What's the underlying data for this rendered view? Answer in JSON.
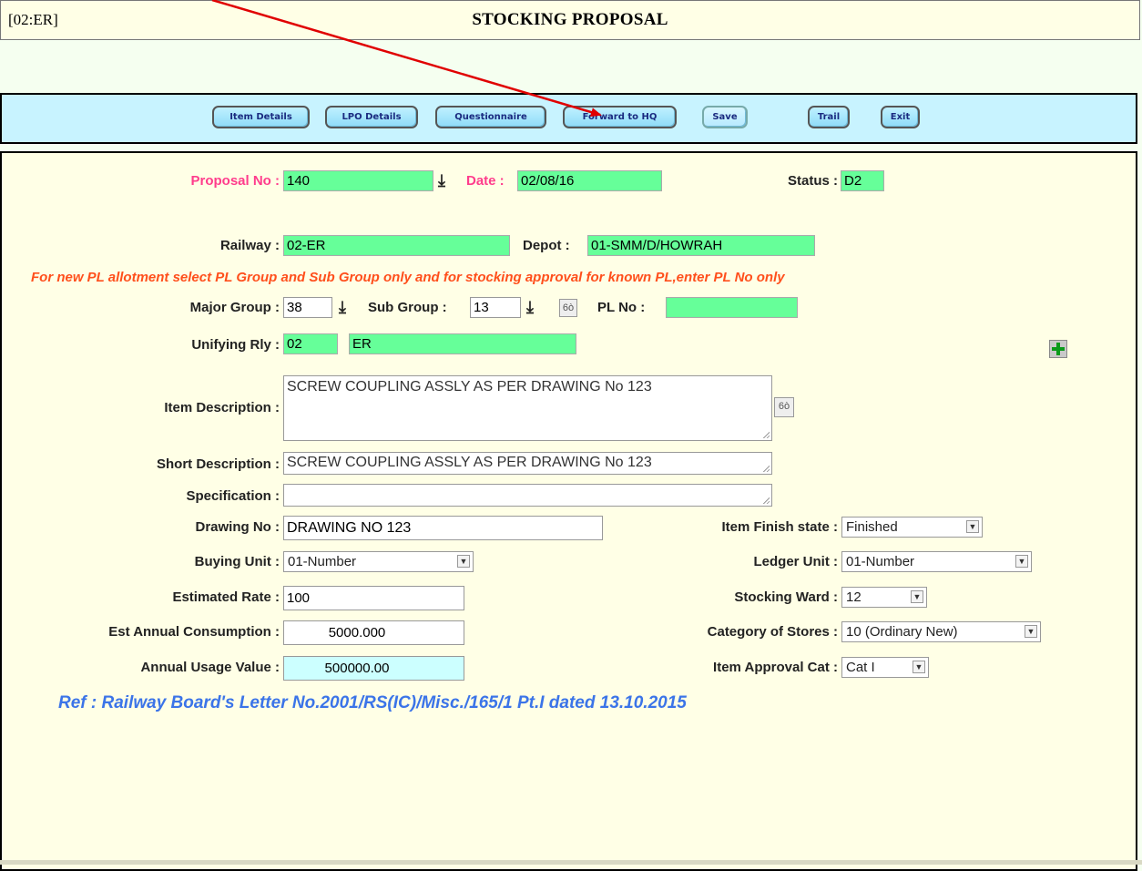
{
  "window": {
    "screen_code": "[02:ER]",
    "title": "STOCKING PROPOSAL"
  },
  "toolbar": {
    "item_details": "Item Details",
    "lpo_details": "LPO Details",
    "questionnaire": "Questionnaire",
    "forward_to_hq": "Forward to HQ",
    "save": "Save",
    "trail": "Trail",
    "exit": "Exit"
  },
  "form": {
    "proposal_no": {
      "label": "Proposal No :",
      "value": "140"
    },
    "date": {
      "label": "Date :",
      "value": "02/08/16"
    },
    "status": {
      "label": "Status :",
      "value": "D2"
    },
    "railway": {
      "label": "Railway :",
      "value": "02-ER"
    },
    "depot": {
      "label": "Depot :",
      "value": "01-SMM/D/HOWRAH"
    },
    "notice": "For new PL allotment select PL Group and Sub Group only and for stocking approval for known PL,enter PL No only",
    "major_group": {
      "label": "Major Group :",
      "value": "38"
    },
    "sub_group": {
      "label": "Sub Group :",
      "value": "13"
    },
    "pl_no": {
      "label": "PL No :",
      "value": ""
    },
    "unifying_rly": {
      "label": "Unifying Rly :",
      "code": "02",
      "name": "ER"
    },
    "item_description": {
      "label": "Item Description :",
      "value": "SCREW COUPLING ASSLY AS PER DRAWING No 123"
    },
    "short_description": {
      "label": "Short Description :",
      "value": "SCREW COUPLING ASSLY AS PER DRAWING No 123"
    },
    "specification": {
      "label": "Specification :",
      "value": ""
    },
    "drawing_no": {
      "label": "Drawing No :",
      "value": "DRAWING NO 123"
    },
    "item_finish_state": {
      "label": "Item Finish state :",
      "value": "Finished"
    },
    "buying_unit": {
      "label": "Buying Unit :",
      "value": "01-Number"
    },
    "ledger_unit": {
      "label": "Ledger Unit :",
      "value": "01-Number"
    },
    "estimated_rate": {
      "label": "Estimated Rate :",
      "value": "100"
    },
    "stocking_ward": {
      "label": "Stocking Ward :",
      "value": "12"
    },
    "est_annual_consumption": {
      "label": "Est Annual Consumption :",
      "value": "5000.000"
    },
    "category_of_stores": {
      "label": "Category of Stores :",
      "value": "10 (Ordinary New)"
    },
    "annual_usage_value": {
      "label": "Annual Usage Value :",
      "value": "500000.00"
    },
    "item_approval_cat": {
      "label": "Item Approval Cat :",
      "value": "Cat I"
    },
    "reference": "Ref : Railway Board's Letter No.2001/RS(IC)/Misc./165/1 Pt.I dated 13.10.2015"
  },
  "icons": {
    "dropdown_arrow": "down-arrow-icon",
    "lookup": "binoculars-icon",
    "add": "add-plus-icon",
    "select_caret": "chevron-down-icon"
  },
  "colors": {
    "highlight_field": "#66ff99",
    "toolbar_bg": "#c8f3ff",
    "annotation_arrow": "#e00000"
  }
}
